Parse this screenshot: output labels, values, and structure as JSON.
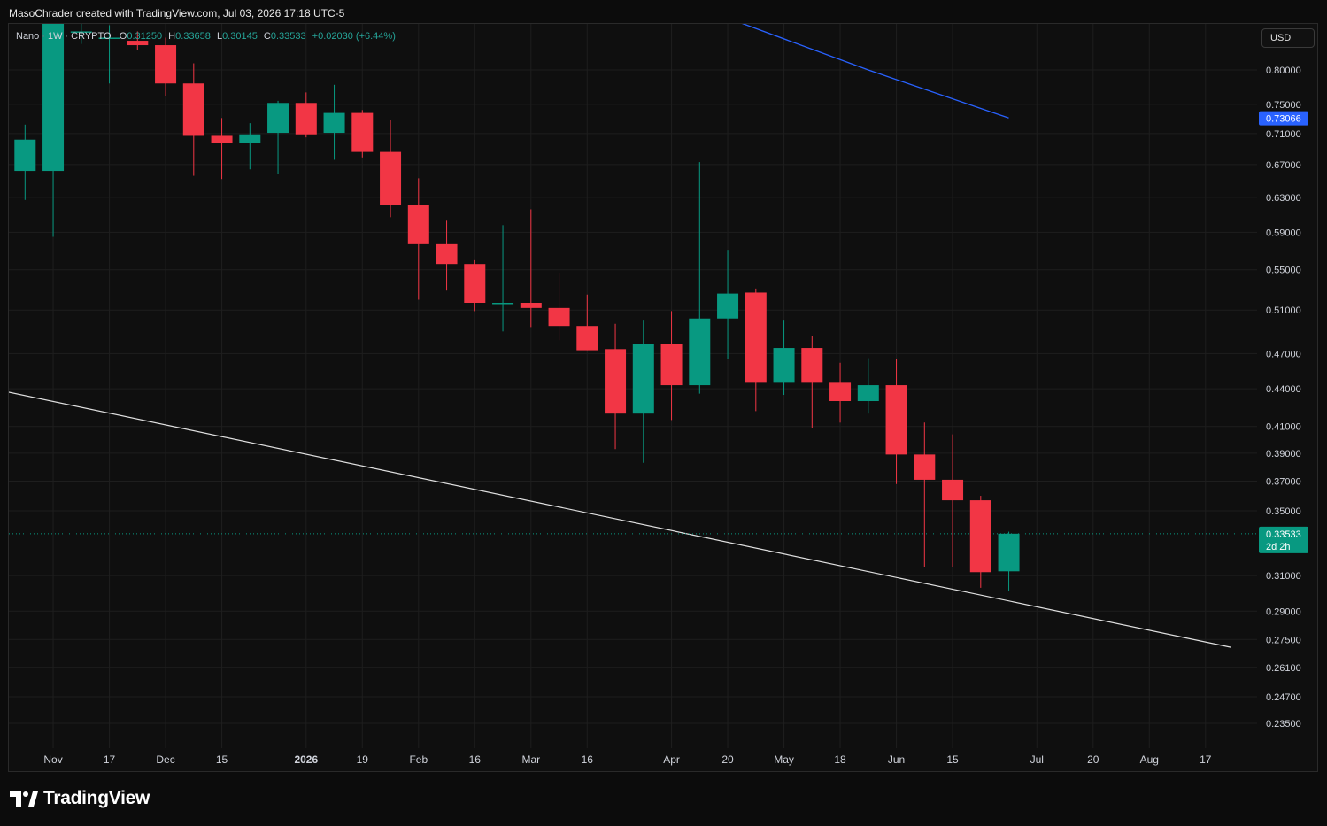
{
  "header": {
    "attribution": "MasoChrader created with TradingView.com, Jul 03, 2026 17:18 UTC-5"
  },
  "legend": {
    "symbol": "Nano",
    "interval": "1W",
    "exchange": "CRYPTO",
    "open_label": "O",
    "open": "0.31250",
    "high_label": "H",
    "high": "0.33658",
    "low_label": "L",
    "low": "0.30145",
    "close_label": "C",
    "close": "0.33533",
    "change": "+0.02030 (+6.44%)"
  },
  "currency_button": {
    "label": "USD"
  },
  "footer": {
    "brand": "TradingView",
    "logo_icon": "tradingview-logo-icon"
  },
  "colors": {
    "up": "#089981",
    "down": "#f23645",
    "ma_blue": "#2962ff",
    "ma_orange": "#f7a21b",
    "trendline": "#e0e0e0",
    "grid": "#1e1e1e"
  },
  "chart_data": {
    "type": "candlestick",
    "scale": "log",
    "price_ticks": [
      "0.80000",
      "0.75000",
      "0.71000",
      "0.67000",
      "0.63000",
      "0.59000",
      "0.55000",
      "0.51000",
      "0.47000",
      "0.44000",
      "0.41000",
      "0.39000",
      "0.37000",
      "0.35000",
      "0.31000",
      "0.29000",
      "0.27500",
      "0.26100",
      "0.24700",
      "0.23500"
    ],
    "time_labels": [
      {
        "text": "Nov",
        "i": 1,
        "bold": false
      },
      {
        "text": "17",
        "i": 3,
        "bold": false
      },
      {
        "text": "Dec",
        "i": 5,
        "bold": false
      },
      {
        "text": "15",
        "i": 7,
        "bold": false
      },
      {
        "text": "2026",
        "i": 10,
        "bold": true
      },
      {
        "text": "19",
        "i": 12,
        "bold": false
      },
      {
        "text": "Feb",
        "i": 14,
        "bold": false
      },
      {
        "text": "16",
        "i": 16,
        "bold": false
      },
      {
        "text": "Mar",
        "i": 18,
        "bold": false
      },
      {
        "text": "16",
        "i": 20,
        "bold": false
      },
      {
        "text": "Apr",
        "i": 23,
        "bold": false
      },
      {
        "text": "20",
        "i": 25,
        "bold": false
      },
      {
        "text": "May",
        "i": 27,
        "bold": false
      },
      {
        "text": "18",
        "i": 29,
        "bold": false
      },
      {
        "text": "Jun",
        "i": 31,
        "bold": false
      },
      {
        "text": "15",
        "i": 33,
        "bold": false
      },
      {
        "text": "Jul",
        "i": 36,
        "bold": false
      },
      {
        "text": "20",
        "i": 38,
        "bold": false
      },
      {
        "text": "Aug",
        "i": 40,
        "bold": false
      },
      {
        "text": "17",
        "i": 42,
        "bold": false
      }
    ],
    "candles": [
      {
        "o": 0.662,
        "h": 0.722,
        "l": 0.627,
        "c": 0.702
      },
      {
        "o": 0.662,
        "h": 0.95,
        "l": 0.585,
        "c": 0.95
      },
      {
        "o": 0.86,
        "h": 0.88,
        "l": 0.84,
        "c": 0.86
      },
      {
        "o": 0.85,
        "h": 0.87,
        "l": 0.78,
        "c": 0.85
      },
      {
        "o": 0.845,
        "h": 0.86,
        "l": 0.83,
        "c": 0.838
      },
      {
        "o": 0.838,
        "h": 0.85,
        "l": 0.762,
        "c": 0.78
      },
      {
        "o": 0.78,
        "h": 0.81,
        "l": 0.656,
        "c": 0.707
      },
      {
        "o": 0.707,
        "h": 0.731,
        "l": 0.652,
        "c": 0.698
      },
      {
        "o": 0.698,
        "h": 0.724,
        "l": 0.664,
        "c": 0.709
      },
      {
        "o": 0.711,
        "h": 0.755,
        "l": 0.658,
        "c": 0.752
      },
      {
        "o": 0.752,
        "h": 0.767,
        "l": 0.705,
        "c": 0.709
      },
      {
        "o": 0.711,
        "h": 0.778,
        "l": 0.676,
        "c": 0.738
      },
      {
        "o": 0.738,
        "h": 0.742,
        "l": 0.679,
        "c": 0.686
      },
      {
        "o": 0.686,
        "h": 0.728,
        "l": 0.607,
        "c": 0.621
      },
      {
        "o": 0.621,
        "h": 0.653,
        "l": 0.52,
        "c": 0.577
      },
      {
        "o": 0.577,
        "h": 0.603,
        "l": 0.529,
        "c": 0.556
      },
      {
        "o": 0.556,
        "h": 0.56,
        "l": 0.509,
        "c": 0.517
      },
      {
        "o": 0.517,
        "h": 0.598,
        "l": 0.49,
        "c": 0.517
      },
      {
        "o": 0.517,
        "h": 0.616,
        "l": 0.494,
        "c": 0.512
      },
      {
        "o": 0.512,
        "h": 0.547,
        "l": 0.482,
        "c": 0.495
      },
      {
        "o": 0.495,
        "h": 0.525,
        "l": 0.473,
        "c": 0.473
      },
      {
        "o": 0.474,
        "h": 0.497,
        "l": 0.393,
        "c": 0.42
      },
      {
        "o": 0.42,
        "h": 0.5,
        "l": 0.383,
        "c": 0.479
      },
      {
        "o": 0.479,
        "h": 0.509,
        "l": 0.415,
        "c": 0.443
      },
      {
        "o": 0.443,
        "h": 0.673,
        "l": 0.436,
        "c": 0.502
      },
      {
        "o": 0.502,
        "h": 0.571,
        "l": 0.465,
        "c": 0.526
      },
      {
        "o": 0.527,
        "h": 0.531,
        "l": 0.422,
        "c": 0.445
      },
      {
        "o": 0.445,
        "h": 0.5,
        "l": 0.435,
        "c": 0.475
      },
      {
        "o": 0.475,
        "h": 0.486,
        "l": 0.409,
        "c": 0.445
      },
      {
        "o": 0.445,
        "h": 0.462,
        "l": 0.413,
        "c": 0.43
      },
      {
        "o": 0.43,
        "h": 0.466,
        "l": 0.42,
        "c": 0.443
      },
      {
        "o": 0.443,
        "h": 0.465,
        "l": 0.368,
        "c": 0.389
      },
      {
        "o": 0.389,
        "h": 0.413,
        "l": 0.315,
        "c": 0.371
      },
      {
        "o": 0.371,
        "h": 0.404,
        "l": 0.315,
        "c": 0.357
      },
      {
        "o": 0.357,
        "h": 0.36,
        "l": 0.303,
        "c": 0.312
      },
      {
        "o": 0.3125,
        "h": 0.33658,
        "l": 0.30145,
        "c": 0.33533
      }
    ],
    "moving_averages": [
      {
        "color": "#2962ff",
        "points": [
          [
            20,
            0.95
          ],
          [
            25.1,
            0.88
          ],
          [
            30,
            0.8
          ],
          [
            35,
            0.731
          ]
        ]
      },
      {
        "color": "#f7a21b",
        "points": [
          [
            31,
            0.96
          ],
          [
            35,
            0.9
          ]
        ]
      }
    ],
    "trendline": {
      "points": [
        [
          -1.15,
          0.44
        ],
        [
          42.9,
          0.271
        ]
      ]
    },
    "current_price": {
      "value": 0.33533,
      "label": "0.33533",
      "countdown": "2d 2h",
      "color": "#089981"
    },
    "ma_price_label": {
      "value": 0.73066,
      "label": "0.73066",
      "color": "#2962ff"
    }
  }
}
